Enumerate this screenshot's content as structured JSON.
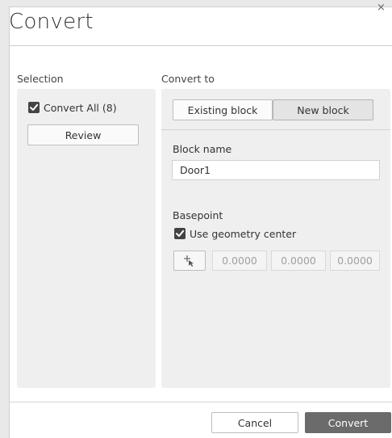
{
  "dialog": {
    "title": "Convert",
    "close_glyph": "×"
  },
  "selection": {
    "label": "Selection",
    "convert_all": {
      "label": "Convert All (8)",
      "checked": true
    },
    "review_label": "Review"
  },
  "convert_to": {
    "label": "Convert to",
    "tabs": [
      {
        "label": "Existing block",
        "selected": false
      },
      {
        "label": "New block",
        "selected": true
      }
    ],
    "block_name": {
      "label": "Block name",
      "value": "Door1"
    },
    "basepoint": {
      "label": "Basepoint",
      "use_geometry_center": {
        "label": "Use geometry center",
        "checked": true
      },
      "pick_icon": "pick-point-icon",
      "coords": [
        "0.0000",
        "0.0000",
        "0.0000"
      ]
    }
  },
  "footer": {
    "cancel_label": "Cancel",
    "convert_label": "Convert"
  },
  "colors": {
    "panel_bg": "#efefef",
    "primary_button": "#6b6b6b",
    "selected_tab": "#e4e4e4"
  }
}
